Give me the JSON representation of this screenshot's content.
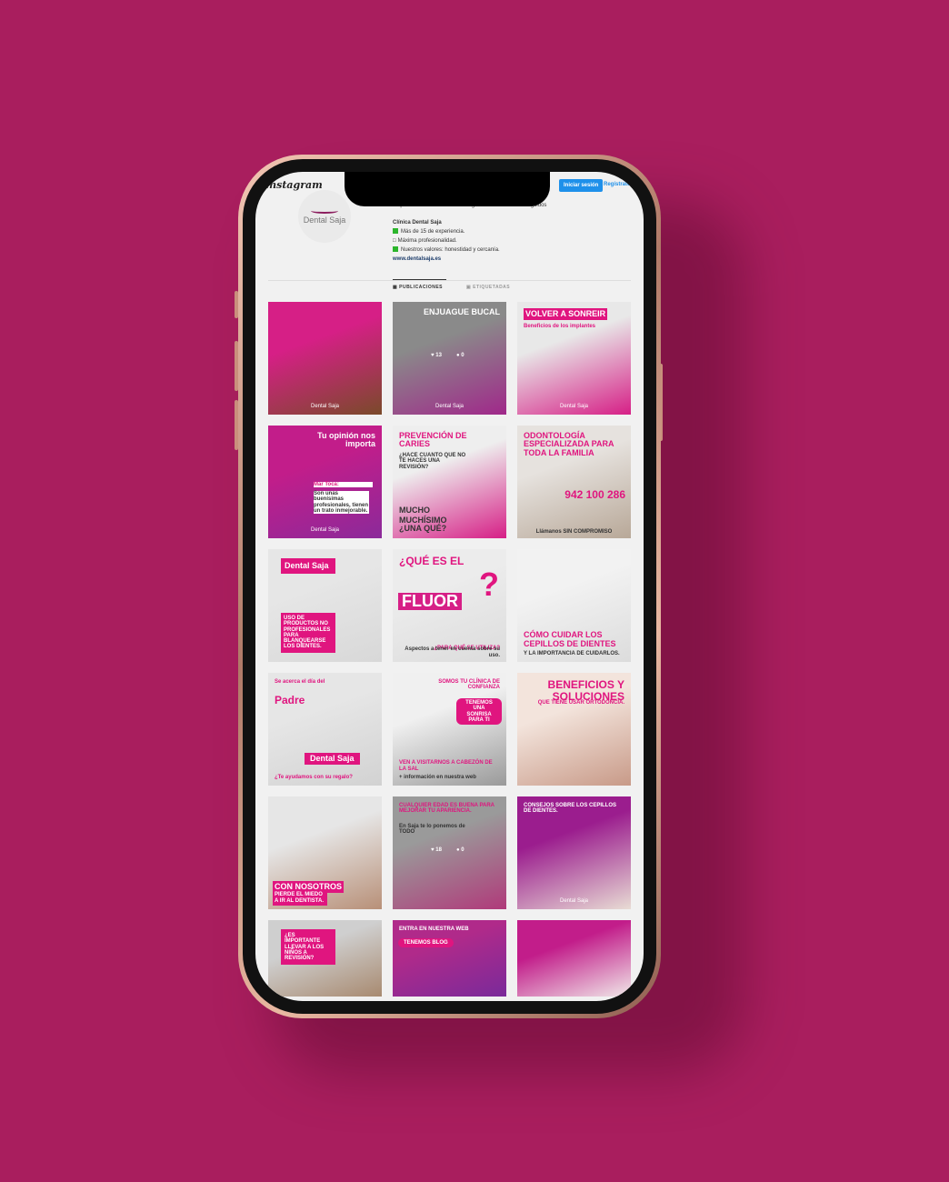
{
  "colors": {
    "background": "#A91E5E",
    "accent": "#E0157F",
    "button": "#1E90EA"
  },
  "header": {
    "app_title": "Instagram",
    "login_label": "Iniciar sesión",
    "register_label": "Regístrate"
  },
  "profile": {
    "avatar_text": "Dental Saja",
    "stats": [
      "20 publicaciones",
      "273 seguidores",
      "219 seguidos"
    ],
    "name": "Clínica Dental Saja",
    "bio": [
      {
        "icon": "green-square-icon",
        "text": "Más de 15 de experiencia."
      },
      {
        "icon": "tooth-icon",
        "text": "Máxima profesionalidad."
      },
      {
        "icon": "green-square-icon",
        "text": "Nuestros valores: honestidad y cercanía."
      }
    ],
    "website": "www.dentalsaja.es"
  },
  "tabs": [
    {
      "label": "PUBLICACIONES",
      "active": true
    },
    {
      "label": "ETIQUETADAS",
      "active": false
    }
  ],
  "posts": [
    {
      "bg": [
        "#d61f86",
        "#7a4a2a"
      ],
      "texts": [],
      "logo": "Dental Saja"
    },
    {
      "bg": [
        "#8a8a8a",
        "#a0288a"
      ],
      "texts": [
        {
          "t": "ENJUAGUE BUCAL",
          "p": "top-right",
          "s": 1
        }
      ],
      "likes": "13",
      "comments": "0",
      "logo": "Dental Saja"
    },
    {
      "bg": [
        "#e8e8e8",
        "#d61f86"
      ],
      "texts": [
        {
          "t": "VOLVER A SONREIR",
          "p": "top",
          "s": 1,
          "box": true
        },
        {
          "t": "Beneficios de los implantes",
          "p": "top2",
          "s": 2,
          "c": "pink"
        }
      ],
      "logo": "Dental Saja"
    },
    {
      "bg": [
        "#c21d8a",
        "#8b2a9a"
      ],
      "texts": [
        {
          "t": "Tu opinión nos importa",
          "p": "top-right",
          "s": 1
        },
        {
          "t": "Mar Toca:",
          "p": "mid",
          "s": 2,
          "c": "pink"
        },
        {
          "t": "Son unas buenísimas profesionales, tienen un trato inmejorable.",
          "p": "mid2",
          "s": 2,
          "c": "dark"
        }
      ],
      "logo": "Dental Saja"
    },
    {
      "bg": [
        "#eeeeee",
        "#d61f86"
      ],
      "texts": [
        {
          "t": "PREVENCIÓN DE CARIES",
          "p": "top",
          "s": 1,
          "c": "pink"
        },
        {
          "t": "¿HACE CUANTO QUE NO TE HACES UNA REVISIÓN?",
          "p": "top3",
          "s": 2,
          "c": "dark"
        },
        {
          "t": "MUCHO",
          "p": "b3",
          "s": 1,
          "c": "dark"
        },
        {
          "t": "MUCHÍSIMO",
          "p": "b2",
          "s": 1,
          "c": "dark"
        },
        {
          "t": "¿UNA QUÉ?",
          "p": "b1",
          "s": 1,
          "c": "dark"
        }
      ]
    },
    {
      "bg": [
        "#e6e2de",
        "#b8a898"
      ],
      "texts": [
        {
          "t": "ODONTOLOGÍA ESPECIALIZADA PARA TODA LA FAMILIA",
          "p": "top",
          "s": 1,
          "c": "pink"
        },
        {
          "t": "942 100 286",
          "p": "mid-right",
          "s": 4,
          "c": "pink"
        },
        {
          "t": "Llámanos SIN COMPROMISO",
          "p": "bottom-center",
          "s": 2,
          "c": "dark"
        }
      ]
    },
    {
      "bg": [
        "#e6e6e6",
        "#d8d8d8"
      ],
      "texts": [
        {
          "t": "Dental Saja",
          "p": "top-box",
          "s": 1
        },
        {
          "t": "USO DE PRODUCTOS NO PROFESIONALES PARA BLANQUEARSE LOS DIENTES.",
          "p": "mid-box",
          "s": 2
        }
      ]
    },
    {
      "bg": [
        "#ececec",
        "#dcdcdc"
      ],
      "texts": [
        {
          "t": "¿QUÉ ES EL",
          "p": "top",
          "s": 4,
          "c": "pink"
        },
        {
          "t": "FLUOR",
          "p": "mid-fluor",
          "s": 3
        },
        {
          "t": "?",
          "p": "mid-q",
          "s": 3,
          "c": "pink"
        },
        {
          "t": "¿PARA QUÉ SE UTILIZA?",
          "p": "b2r",
          "s": 2,
          "c": "pink"
        },
        {
          "t": "Aspectos a tener en cuenta sobre su uso.",
          "p": "b1r",
          "s": 2,
          "c": "dark"
        }
      ]
    },
    {
      "bg": [
        "#f2f2f2",
        "#dcdcdc"
      ],
      "texts": [
        {
          "t": "CÓMO CUIDAR LOS CEPILLOS DE DIENTES",
          "p": "b2",
          "s": 1,
          "c": "pink"
        },
        {
          "t": "Y LA IMPORTANCIA DE CUIDARLOS.",
          "p": "b1",
          "s": 2,
          "c": "dark"
        }
      ]
    },
    {
      "bg": [
        "#e6e6e6",
        "#d2d2d2"
      ],
      "texts": [
        {
          "t": "Se acerca el día del",
          "p": "top",
          "s": 2,
          "c": "pink"
        },
        {
          "t": "Padre",
          "p": "top2",
          "s": 4,
          "c": "pink"
        },
        {
          "t": "Dental Saja",
          "p": "mid-box2",
          "s": 1
        },
        {
          "t": "¿Te ayudamos con su regalo?",
          "p": "b1",
          "s": 2,
          "c": "pink"
        }
      ]
    },
    {
      "bg": [
        "#f0f0f0",
        "#9a9a9a"
      ],
      "texts": [
        {
          "t": "SOMOS TU CLÍNICA DE CONFIANZA",
          "p": "top-right",
          "s": 2,
          "c": "pink"
        },
        {
          "t": "TENEMOS UNA SONRISA PARA TI",
          "p": "top-pill",
          "s": 2
        },
        {
          "t": "VEN A VISITARNOS A CABEZÓN DE LA SAL",
          "p": "b2",
          "s": 2,
          "c": "pink"
        },
        {
          "t": "+ información en nuestra web",
          "p": "b1",
          "s": 2,
          "c": "dark"
        }
      ]
    },
    {
      "bg": [
        "#f3e4dc",
        "#c89a88"
      ],
      "texts": [
        {
          "t": "BENEFICIOS Y SOLUCIONES",
          "p": "top-right",
          "s": 4,
          "c": "pink"
        },
        {
          "t": "QUE TIENE USAR ORTODONCIA.",
          "p": "top3r",
          "s": 2,
          "c": "pink"
        }
      ]
    },
    {
      "bg": [
        "#e6e6e6",
        "#b89078"
      ],
      "texts": [
        {
          "t": "CON NOSOTROS",
          "p": "b2box",
          "s": 1
        },
        {
          "t": "PIERDE EL MIEDO A IR AL DENTISTA.",
          "p": "b1box",
          "s": 2
        }
      ]
    },
    {
      "bg": [
        "#9a9a9a",
        "#b03a7a"
      ],
      "texts": [
        {
          "t": "CUALQUIER EDAD ES BUENA PARA MEJORAR TU APARIENCIA.",
          "p": "top",
          "s": 2,
          "c": "pink"
        },
        {
          "t": "En Saja te lo ponemos de TODO",
          "p": "top3",
          "s": 2,
          "c": "dark"
        }
      ],
      "likes": "18",
      "comments": "0"
    },
    {
      "bg": [
        "#9b1d8e",
        "#e8dcd4"
      ],
      "texts": [
        {
          "t": "CONSEJOS SOBRE LOS CEPILLOS DE DIENTES.",
          "p": "top",
          "s": 2
        }
      ],
      "logo": "Dental Saja"
    },
    {
      "bg": [
        "#cfcfcf",
        "#a88a70"
      ],
      "texts": [
        {
          "t": "¿ES IMPORTANTE LLEVAR A LOS NIÑOS A REVISIÓN?",
          "p": "top-box",
          "s": 2
        }
      ]
    },
    {
      "bg": [
        "#b02a8a",
        "#7a2a9a"
      ],
      "texts": [
        {
          "t": "ENTRA EN NUESTRA WEB",
          "p": "top",
          "s": 2
        },
        {
          "t": "TENEMOS BLOG",
          "p": "top-pill-l",
          "s": 2
        }
      ]
    },
    {
      "bg": [
        "#c21d8a",
        "#f0e8e8"
      ],
      "texts": []
    }
  ]
}
